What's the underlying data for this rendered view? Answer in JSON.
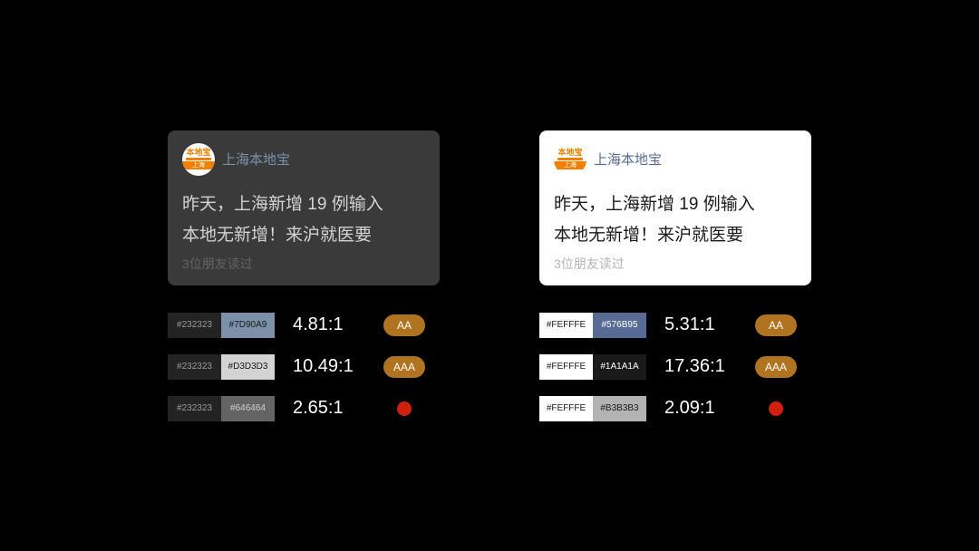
{
  "left": {
    "source": "上海本地宝",
    "avatar": {
      "top": "本地宝",
      "bot": "上海"
    },
    "headline1": "昨天，上海新增 19 例输入",
    "headline2": "本地无新增！来沪就医要",
    "subtext": "3位朋友读过",
    "rows": [
      {
        "bg": "#232323",
        "bgLabelColor": "#9a9a9a",
        "fg": "#7D90A9",
        "fgLabelColor": "#1a1a1a",
        "ratio": "4.81:1",
        "grade": "AA"
      },
      {
        "bg": "#232323",
        "bgLabelColor": "#9a9a9a",
        "fg": "#D3D3D3",
        "fgLabelColor": "#1a1a1a",
        "ratio": "10.49:1",
        "grade": "AAA"
      },
      {
        "bg": "#232323",
        "bgLabelColor": "#9a9a9a",
        "fg": "#646464",
        "fgLabelColor": "#d0d0d0",
        "ratio": "2.65:1",
        "grade": "FAIL"
      }
    ]
  },
  "right": {
    "source": "上海本地宝",
    "avatar": {
      "top": "本地宝",
      "bot": "上海"
    },
    "headline1": "昨天，上海新增 19 例输入",
    "headline2": "本地无新增！来沪就医要",
    "subtext": "3位朋友读过",
    "rows": [
      {
        "bg": "#FEFFFE",
        "bgLabelColor": "#1a1a1a",
        "fg": "#576B95",
        "fgLabelColor": "#fff",
        "ratio": "5.31:1",
        "grade": "AA"
      },
      {
        "bg": "#FEFFFE",
        "bgLabelColor": "#1a1a1a",
        "fg": "#1A1A1A",
        "fgLabelColor": "#fff",
        "ratio": "17.36:1",
        "grade": "AAA"
      },
      {
        "bg": "#FEFFFE",
        "bgLabelColor": "#1a1a1a",
        "fg": "#B3B3B3",
        "fgLabelColor": "#1a1a1a",
        "ratio": "2.09:1",
        "grade": "FAIL"
      }
    ]
  }
}
